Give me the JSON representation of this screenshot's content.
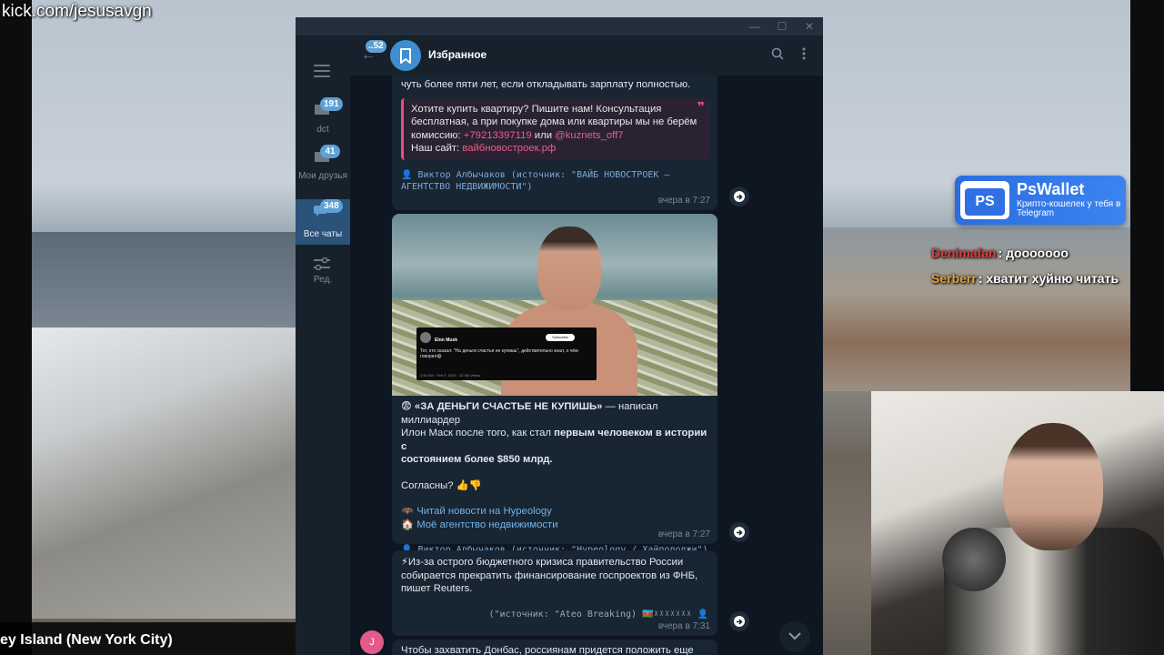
{
  "stream": {
    "watermark": "kick.com/jesusavgn",
    "location_caption": "ey Island (New York City)",
    "pswallet": {
      "title": "PsWallet",
      "subtitle": "Крипто-кошелек у тебя в Telegram",
      "logo": "PS"
    },
    "chat": [
      {
        "name": "Denimafan",
        "text": ": дооооооо",
        "color": "#e03a3a"
      },
      {
        "name": "Serberr",
        "text": ": хватит хуйню читать",
        "color": "#e0a040"
      }
    ]
  },
  "telegram": {
    "window_controls": {
      "minimize": "—",
      "maximize": "☐",
      "close": "✕"
    },
    "rail": [
      {
        "label": "dct",
        "badge": "191",
        "icon": "folder-icon"
      },
      {
        "label": "Мои друзья",
        "badge": "41",
        "icon": "folder-icon"
      },
      {
        "label": "Все чаты",
        "badge": "348",
        "icon": "chats-icon"
      },
      {
        "label": "Ред.",
        "badge": "",
        "icon": "sliders-icon"
      }
    ],
    "header": {
      "back_badge": "52",
      "title": "Избранное"
    },
    "messages": {
      "m1": {
        "top_text": "чуть более пяти лет, если откладывать зарплату полностью.",
        "quote_line1": "Хотите купить квартиру? Пишите нам! Консультация",
        "quote_line2": "бесплатная, а при покупке дома или квартиры мы не берём",
        "quote_line3_a": "комиссию: ",
        "quote_phone": "+79213397119",
        "quote_or": " или ",
        "quote_handle": "@kuznets_off7",
        "quote_site_label": "Наш сайт: ",
        "quote_site": "вайбновостроек.рф",
        "source_line1": "👤 Виктор Албычаков (источник: \"ВАЙБ НОВОСТРОЕК –",
        "source_line2": "АГЕНТСТВО НЕДВИЖИМОСТИ\")",
        "time": "вчера в 7:27"
      },
      "m2": {
        "tweet_name": "Elon Musk",
        "tweet_subscribe": "Subscribe",
        "tweet_text": "Тот, кто сказал: \"На деньги счастья не купишь\", действительно знал, о чём говорил😄",
        "tweet_date": "3:50 AM · Feb 5, 2026 · 32.9M Views",
        "headline_emoji": "😨",
        "headline_bold": "«ЗА ДЕНЬГИ СЧАСТЬЕ НЕ КУПИШЬ»",
        "headline_rest": " — написал миллиардер",
        "line2_a": "Илон Маск после того, как стал ",
        "line2_bold": "первым человеком в истории с",
        "line3_bold": "состоянием более $850 млрд.",
        "question": "Согласны? 👍👎",
        "link1": "Читай новости на Hypeology",
        "link1_icon": "🦇",
        "link2": "Моё агентство недвижимости",
        "link2_icon": "🏠",
        "source": "👤 Виктор Албычаков (источник: \"Hypeology / Хайполоджи\")",
        "time": "вчера в 7:27"
      },
      "m3": {
        "line1": "⚡Из-за острого бюджетного кризиса правительство России",
        "line2": "собирается прекратить финансирование госпроектов из ФНБ,",
        "line3": "пишет Reuters.",
        "source": "(\"источник: \"Ateo Breaking) 🇦🇿ᵡᵡᵡᵡᵡᵡᵡ 👤",
        "time": "вчера в 7:31"
      },
      "m4": {
        "text": "Чтобы захватить Донбас, россиянам придется положить еще",
        "avatar_letter": "J"
      }
    }
  }
}
